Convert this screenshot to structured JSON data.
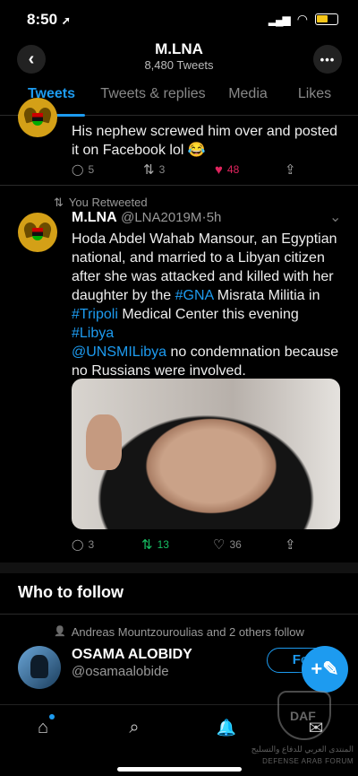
{
  "status_bar": {
    "time": "8:50",
    "location_glyph": "➚",
    "signal_glyph": "▂▄▆",
    "wifi_glyph": "◠"
  },
  "header": {
    "back_glyph": "‹",
    "title": "M.LNA",
    "subtitle": "8,480 Tweets",
    "more_glyph": "•••"
  },
  "tabs": [
    "Tweets",
    "Tweets & replies",
    "Media",
    "Likes"
  ],
  "tweet1": {
    "text": "His nephew screwed him over and posted it on Facebook lol 😂",
    "replies": "5",
    "retweets": "3",
    "likes": "48",
    "reply_glyph": "◯",
    "retweet_glyph": "⇅",
    "like_glyph": "♥",
    "share_glyph": "⇪",
    "like_color": "#e0245e"
  },
  "tweet2": {
    "retweet_label": "You Retweeted",
    "name": "M.LNA",
    "handle": "@LNA2019M",
    "dot": "·",
    "time": "5h",
    "caret": "⌄",
    "text_parts": {
      "p1": "Hoda Abdel Wahab Mansour, an Egyptian national, and married to a Libyan citizen after she was attacked  and killed with her daughter by the ",
      "gna": "#GNA",
      "p2": " Misrata Militia in ",
      "tripoli": "#Tripoli",
      "p3": " Medical Center this evening ",
      "libya": "#Libya",
      "unsmil": "@UNSMILibya",
      "p4": "  no condemnation because no Russians were involved."
    },
    "replies": "3",
    "retweets": "13",
    "likes": "36",
    "retweet_color": "#17bf63"
  },
  "who_to_follow": {
    "title": "Who to follow",
    "social_proof": "Andreas Mountzouroulias and 2 others follow",
    "person_glyph": "👤",
    "name": "OSAMA ALOBIDY",
    "handle": "@osamaalobide",
    "follow_label": "Fol",
    "compose_glyph": "+✎"
  },
  "bottom_nav": {
    "home_glyph": "⌂",
    "search_glyph": "⌕",
    "notifications_glyph": "🔔",
    "messages_glyph": "✉"
  },
  "watermark": {
    "line1": "المنتدى العربي للدفاع والتسليح",
    "line2": "DEFENSE ARAB FORUM",
    "mark": "DAF"
  },
  "colors": {
    "accent": "#1d9bf0",
    "background": "#000000"
  }
}
